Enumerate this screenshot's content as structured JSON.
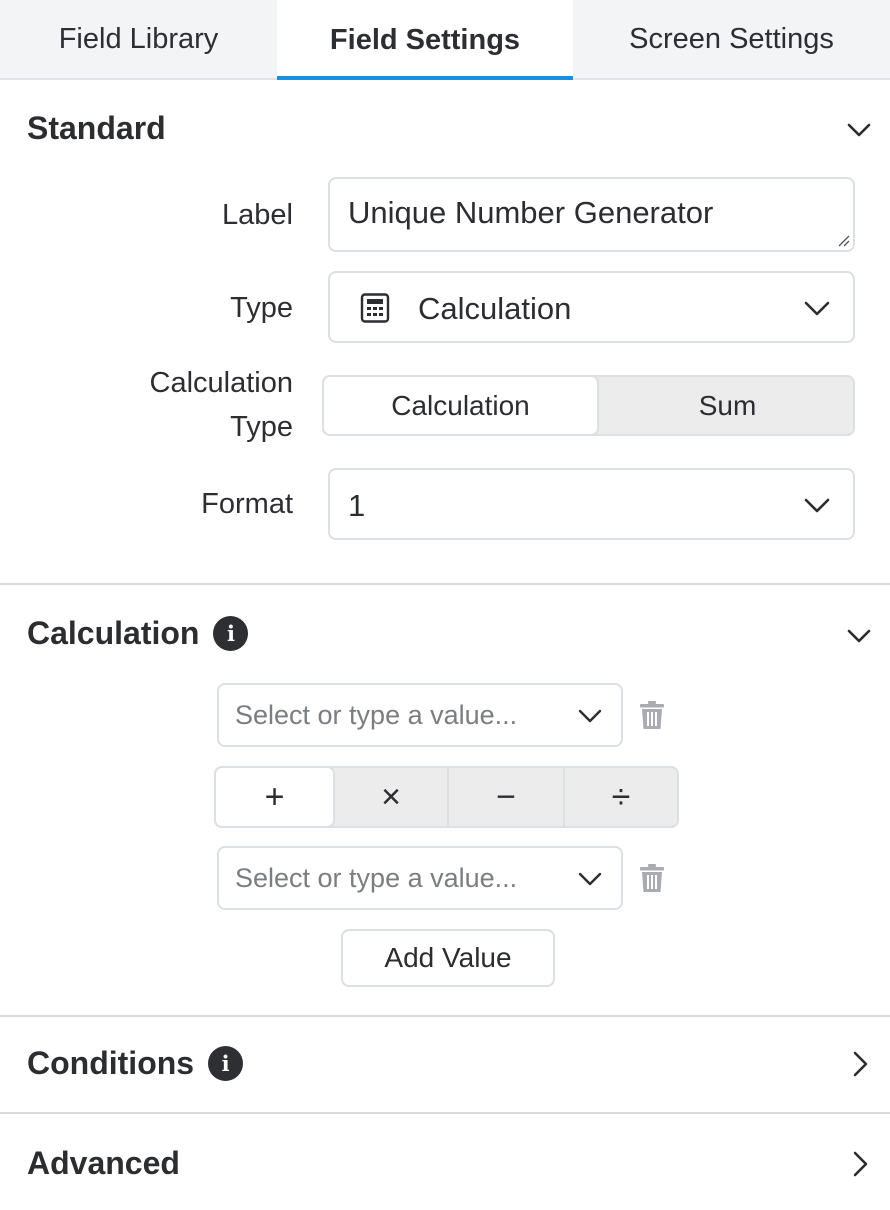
{
  "tabs": [
    {
      "label": "Field Library"
    },
    {
      "label": "Field Settings"
    },
    {
      "label": "Screen Settings"
    }
  ],
  "standard": {
    "title": "Standard",
    "label_label": "Label",
    "label_value": "Unique Number Generator",
    "type_label": "Type",
    "type_value": "Calculation",
    "calc_type_label_1": "Calculation",
    "calc_type_label_2": "Type",
    "calc_type_options": [
      "Calculation",
      "Sum"
    ],
    "format_label": "Format",
    "format_value": "1"
  },
  "calculation": {
    "title": "Calculation",
    "value_placeholder": "Select or type a value...",
    "operators": [
      "+",
      "×",
      "−",
      "÷"
    ],
    "add_value_label": "Add Value"
  },
  "conditions": {
    "title": "Conditions"
  },
  "advanced": {
    "title": "Advanced"
  },
  "colors": {
    "accent": "#1a8fe0",
    "divider": "#d7dbe0"
  }
}
